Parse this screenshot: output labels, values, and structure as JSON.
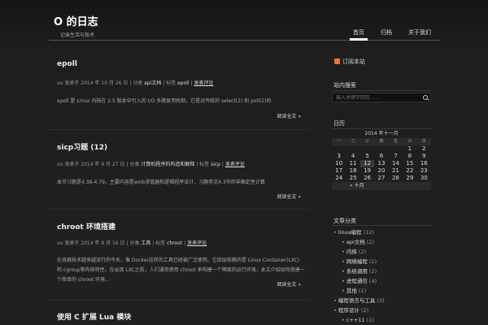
{
  "header": {
    "title": "O 的日志",
    "description": "记录生活与技术",
    "nav": [
      "首页",
      "归档",
      "关于我们"
    ]
  },
  "posts": [
    {
      "title": "epoll",
      "meta_by": "ou 发表于 ",
      "date": "2014 年 10 月 26 日",
      "meta_mid": " | 分类 ",
      "category": "api文档",
      "meta_tag": " | 标签 ",
      "tag": "epoll",
      "comments": "发表评论",
      "excerpt": "epoll 是 Linux 内核在 2.5 版本中引入的 I/O 多路复用机制，它是对传统的 select(2) 和 poll(2)的",
      "more": "阅读全文 »"
    },
    {
      "title": "sicp习题 (12)",
      "meta_by": "ou 发表于 ",
      "date": "2014 年 9 月 27 日",
      "meta_mid": " | 分类 ",
      "category": "计算机程序的构造和解释",
      "meta_tag": " | 标签 ",
      "tag": "sicp",
      "comments": "发表评论",
      "excerpt": "本节习题是4.38-4.79，主要内容是amb求值器和逻辑程序设计，习题参见4.3节的非确定性计算",
      "more": "阅读全文 »"
    },
    {
      "title": "chroot 环境搭建",
      "meta_by": "ou 发表于 ",
      "date": "2014 年 8 月 16 日",
      "meta_mid": " | 分类 ",
      "category": "工具",
      "meta_tag": " | 标签 ",
      "tag": "chroot",
      "comments": "发表评论",
      "excerpt": "在容器技术越来越流行的今天，像 Docker这样的工具已经被广泛使用。它底层依赖的是 Linux Container(LXC) 和 cgroup等内核特性。在出现 LXC之前，人们通常使用 chroot 来构建一个隔离的运行环境，本文介绍如何搭建一个简单的 chroot 环境...",
      "more": "阅读全文 »"
    },
    {
      "title": "使用 C 扩展 Lua 模块"
    }
  ],
  "sidebar": {
    "rss_label": "订阅本站",
    "search_title": "站内搜索",
    "search_placeholder": "输入关键字回车……",
    "calendar_title": "日历",
    "calendar_caption": "2014 年十一月",
    "weekdays": [
      "一",
      "二",
      "三",
      "四",
      "五",
      "六",
      "日"
    ],
    "calendar_weeks": [
      [
        "",
        "",
        "",
        "",
        "",
        "1",
        "2"
      ],
      [
        "3",
        "4",
        "5",
        "6",
        "7",
        "8",
        "9"
      ],
      [
        "10",
        "11",
        "12",
        "13",
        "14",
        "15",
        "16"
      ],
      [
        "17",
        "18",
        "19",
        "20",
        "21",
        "22",
        "23"
      ],
      [
        "24",
        "25",
        "26",
        "27",
        "28",
        "29",
        "30"
      ]
    ],
    "today": "12",
    "calendar_prev": "« 十月",
    "categories_title": "文章分类",
    "categories": [
      {
        "name": "linux编程",
        "count": "(12)",
        "level": 0
      },
      {
        "name": "api文档",
        "count": "(2)",
        "level": 1
      },
      {
        "name": "内核",
        "count": "(2)",
        "level": 1
      },
      {
        "name": "网络编程",
        "count": "(1)",
        "level": 1
      },
      {
        "name": "系统调用",
        "count": "(2)",
        "level": 1
      },
      {
        "name": "进程通信",
        "count": "(4)",
        "level": 1
      },
      {
        "name": "其他",
        "count": "(1)",
        "level": 1
      },
      {
        "name": "编程语言与工具",
        "count": "(3)",
        "level": 0
      },
      {
        "name": "程序设计",
        "count": "(2)",
        "level": 0
      },
      {
        "name": "c++11",
        "count": "(1)",
        "level": 1
      }
    ]
  }
}
